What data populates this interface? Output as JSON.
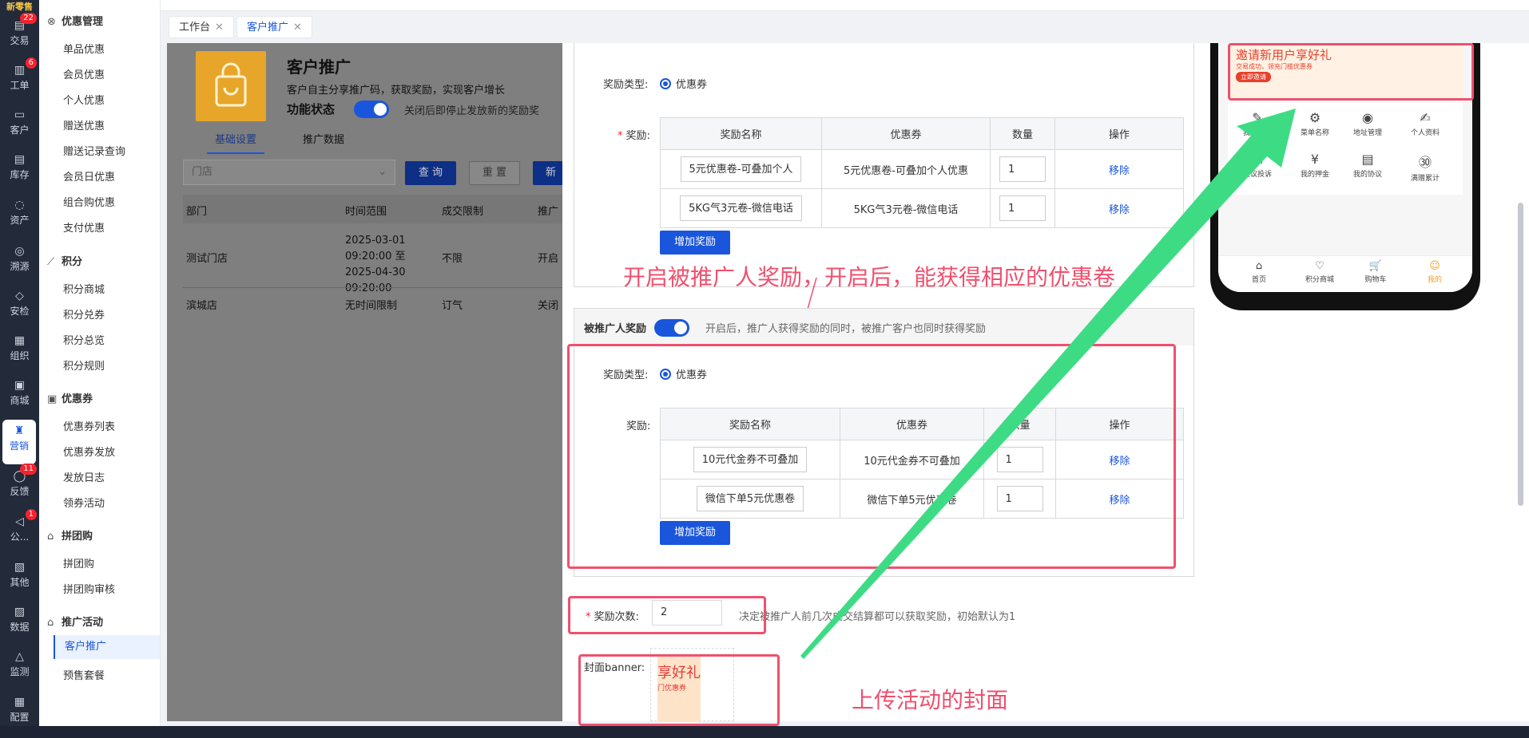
{
  "rail": {
    "brand": "新零售",
    "items": [
      {
        "label": "交易",
        "icon": "trade-icon",
        "badge": "22"
      },
      {
        "label": "工单",
        "icon": "ticket-icon",
        "badge": "6"
      },
      {
        "label": "客户",
        "icon": "customer-icon",
        "badge": ""
      },
      {
        "label": "库存",
        "icon": "inventory-icon",
        "badge": ""
      },
      {
        "label": "资产",
        "icon": "bulb-icon",
        "badge": ""
      },
      {
        "label": "溯源",
        "icon": "compass-icon",
        "badge": ""
      },
      {
        "label": "安检",
        "icon": "shield-icon",
        "badge": ""
      },
      {
        "label": "组织",
        "icon": "org-icon",
        "badge": ""
      },
      {
        "label": "商城",
        "icon": "store-icon",
        "badge": ""
      },
      {
        "label": "营销",
        "icon": "trophy-icon",
        "badge": ""
      },
      {
        "label": "反馈",
        "icon": "feedback-icon",
        "badge": "11"
      },
      {
        "label": "公...",
        "icon": "announce-icon",
        "badge": "1"
      },
      {
        "label": "其他",
        "icon": "other-icon",
        "badge": ""
      },
      {
        "label": "数据",
        "icon": "chart-icon",
        "badge": ""
      },
      {
        "label": "监测",
        "icon": "alarm-icon",
        "badge": ""
      },
      {
        "label": "配置",
        "icon": "grid-icon",
        "badge": ""
      }
    ]
  },
  "menu": {
    "g1": "优惠管理",
    "g1_items": [
      "单品优惠",
      "会员优惠",
      "个人优惠",
      "赠送优惠",
      "赠送记录查询",
      "会员日优惠",
      "组合购优惠",
      "支付优惠"
    ],
    "g2": "积分",
    "g2_items": [
      "积分商城",
      "积分兑券",
      "积分总览",
      "积分规则"
    ],
    "g3": "优惠券",
    "g3_items": [
      "优惠券列表",
      "优惠券发放",
      "发放日志",
      "领券活动"
    ],
    "g4": "拼团购",
    "g4_items": [
      "拼团购",
      "拼团购审核"
    ],
    "g5": "推广活动",
    "g5_items": [
      "客户推广",
      "预售套餐"
    ]
  },
  "tabs": [
    {
      "label": "工作台"
    },
    {
      "label": "客户推广"
    }
  ],
  "overlay": {
    "title": "客户推广",
    "desc": "客户自主分享推广码，获取奖励，实现客户增长",
    "status_label": "功能状态",
    "status_hint": "关闭后即停止发放新的奖励奖",
    "tab_basic": "基础设置",
    "tab_data": "推广数据",
    "store_placeholder": "门店",
    "query": "查 询",
    "reset": "重 置",
    "new": "新 增",
    "cols": [
      "部门",
      "时间范围",
      "成交限制",
      "推广"
    ],
    "rows": [
      {
        "dept": "测试门店",
        "time": "2025-03-01 09:20:00 至 2025-04-30 09:20:00",
        "limit": "不限",
        "state": "开启"
      },
      {
        "dept": "滨城店",
        "time": "无时间限制",
        "limit": "订气",
        "state": "关闭"
      }
    ]
  },
  "reward1": {
    "type_label": "奖励类型:",
    "type_value": "优惠券",
    "reward_label": "奖励:",
    "cols": [
      "奖励名称",
      "优惠券",
      "数量",
      "操作"
    ],
    "rows": [
      {
        "name": "5元优惠卷-可叠加个人",
        "coupon": "5元优惠卷-可叠加个人优惠",
        "qty": "1",
        "op": "移除"
      },
      {
        "name": "5KG气3元卷-微信电话",
        "coupon": "5KG气3元卷-微信电话",
        "qty": "1",
        "op": "移除"
      }
    ],
    "add_btn": "增加奖励"
  },
  "ann1": "开启被推广人奖励，开启后，能获得相应的优惠卷",
  "invitee": {
    "title": "被推广人奖励",
    "hint": "开启后，推广人获得奖励的同时，被推广客户也同时获得奖励"
  },
  "reward2": {
    "type_label": "奖励类型:",
    "type_value": "优惠券",
    "reward_label": "奖励:",
    "cols": [
      "奖励名称",
      "优惠券",
      "数量",
      "操作"
    ],
    "rows": [
      {
        "name": "10元代金券不可叠加",
        "coupon": "10元代金券不可叠加",
        "qty": "1",
        "op": "移除"
      },
      {
        "name": "微信下单5元优惠卷",
        "coupon": "微信下单5元优惠卷",
        "qty": "1",
        "op": "移除"
      }
    ],
    "add_btn": "增加奖励"
  },
  "count": {
    "label": "奖励次数:",
    "value": "2",
    "hint": "决定被推广人前几次成交结算都可以获取奖励，初始默认为1"
  },
  "banner": {
    "label": "封面banner:",
    "img_text1": "享好礼",
    "img_text2": "门优惠券"
  },
  "ann2": "上传活动的封面",
  "phone": {
    "banner_title": "邀请新用户享好礼",
    "banner_sub": "交易成功，领充门槛优惠券",
    "banner_btn": "立即邀请",
    "row1": [
      "我的维修",
      "菜单名称",
      "地址管理",
      "个人资料"
    ],
    "row2": [
      "建议投诉",
      "我的押金",
      "我的协议",
      "满赠累计"
    ],
    "nav": [
      "首页",
      "积分商城",
      "购物车",
      "我的"
    ]
  },
  "colors": {
    "accent": "#1a56db",
    "annotation": "#f0506e",
    "arrow": "#3ddc84"
  }
}
